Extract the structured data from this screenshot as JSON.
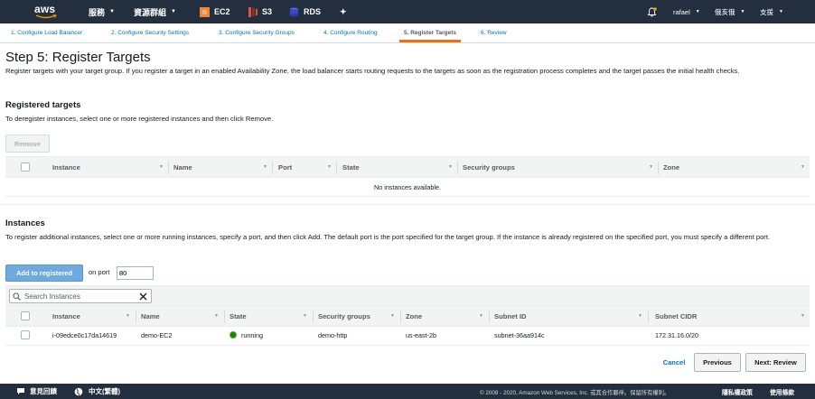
{
  "topnav": {
    "logo_text": "aws",
    "services_label": "服務",
    "resource_groups_label": "資源群組",
    "shortcuts": [
      {
        "label": "EC2",
        "icon": "ec2-icon",
        "color": "#f58536"
      },
      {
        "label": "S3",
        "icon": "s3-icon",
        "color": "#e05243"
      },
      {
        "label": "RDS",
        "icon": "rds-icon",
        "color": "#3b48cc"
      }
    ],
    "user_label": "rafael",
    "region_label": "俄亥俄",
    "support_label": "支援"
  },
  "wizard": {
    "tabs": [
      {
        "label": "1. Configure Load Balancer",
        "active": false
      },
      {
        "label": "2. Configure Security Settings",
        "active": false
      },
      {
        "label": "3. Configure Security Groups",
        "active": false
      },
      {
        "label": "4. Configure Routing",
        "active": false
      },
      {
        "label": "5. Register Targets",
        "active": true
      },
      {
        "label": "6. Review",
        "active": false
      }
    ]
  },
  "page": {
    "title": "Step 5: Register Targets",
    "intro": "Register targets with your target group. If you register a target in an enabled Availability Zone, the load balancer starts routing requests to the targets as soon as the registration process completes and the target passes the initial health checks."
  },
  "registered": {
    "heading": "Registered targets",
    "description": "To deregister instances, select one or more registered instances and then click Remove.",
    "remove_label": "Remove",
    "columns": [
      "Instance",
      "Name",
      "Port",
      "State",
      "Security groups",
      "Zone"
    ],
    "empty_text": "No instances available."
  },
  "instances": {
    "heading": "Instances",
    "description": "To register additional instances, select one or more running instances, specify a port, and then click Add. The default port is the port specified for the target group. If the instance is already registered on the specified port, you must specify a different port.",
    "add_label": "Add to registered",
    "port_label": "on port",
    "port_value": "80",
    "search_placeholder": "Search Instances",
    "columns": [
      "Instance",
      "Name",
      "State",
      "Security groups",
      "Zone",
      "Subnet ID",
      "Subnet CIDR"
    ],
    "rows": [
      {
        "instance": "i-09edce0c17da14619",
        "name": "demo-EC2",
        "state": "running",
        "security_groups": "demo-http",
        "zone": "us-east-2b",
        "subnet_id": "subnet-36aa914c",
        "subnet_cidr": "172.31.16.0/20"
      }
    ]
  },
  "actions": {
    "cancel_label": "Cancel",
    "previous_label": "Previous",
    "next_label": "Next: Review"
  },
  "footer": {
    "feedback_label": "意見回饋",
    "language_label": "中文(繁體)",
    "copyright": "© 2008 - 2020, Amazon Web Services, Inc. 或其合作夥伴。保留所有權利。",
    "privacy_label": "隱私權政策",
    "terms_label": "使用條款"
  }
}
